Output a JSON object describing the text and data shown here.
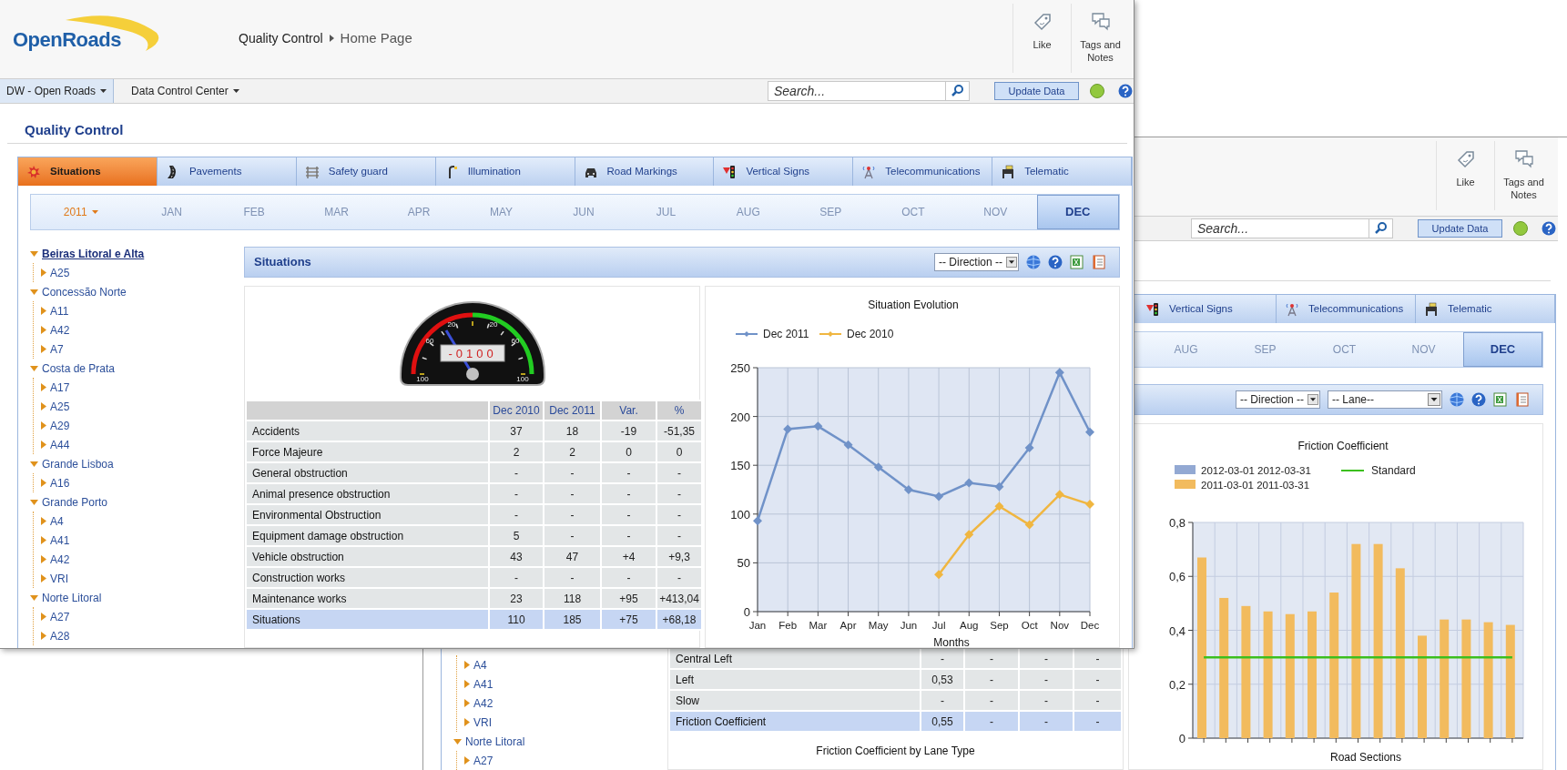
{
  "front_window": {
    "logo": "OpenRoads",
    "breadcrumb": [
      "Quality Control",
      "Home Page"
    ],
    "actions": [
      {
        "label": "Like"
      },
      {
        "label": "Tags and Notes"
      }
    ],
    "nav_menus": [
      {
        "label": "DW - Open Roads",
        "selected": true
      },
      {
        "label": "Data Control Center",
        "selected": false
      }
    ],
    "search": {
      "placeholder": "Search..."
    },
    "update_button": "Update Data",
    "page_heading": "Quality Control",
    "tabs": [
      {
        "label": "Situations",
        "selected": true
      },
      {
        "label": "Pavements",
        "selected": false
      },
      {
        "label": "Safety guard",
        "selected": false
      },
      {
        "label": "Illumination",
        "selected": false
      },
      {
        "label": "Road Markings",
        "selected": false
      },
      {
        "label": "Vertical Signs",
        "selected": false
      },
      {
        "label": "Telecommunications",
        "selected": false
      },
      {
        "label": "Telematic",
        "selected": false
      }
    ],
    "year": "2011",
    "months": [
      {
        "label": "JAN",
        "selected": false
      },
      {
        "label": "FEB",
        "selected": false
      },
      {
        "label": "MAR",
        "selected": false
      },
      {
        "label": "APR",
        "selected": false
      },
      {
        "label": "MAY",
        "selected": false
      },
      {
        "label": "JUN",
        "selected": false
      },
      {
        "label": "JUL",
        "selected": false
      },
      {
        "label": "AUG",
        "selected": false
      },
      {
        "label": "SEP",
        "selected": false
      },
      {
        "label": "OCT",
        "selected": false
      },
      {
        "label": "NOV",
        "selected": false
      },
      {
        "label": "DEC",
        "selected": true
      }
    ],
    "tree": [
      {
        "label": "Beiras Litoral e Alta",
        "expanded": true,
        "selected": true,
        "children": [
          {
            "label": "A25",
            "expanded": false,
            "selected": false
          }
        ]
      },
      {
        "label": "Concessão Norte",
        "expanded": true,
        "selected": false,
        "children": [
          {
            "label": "A11",
            "expanded": false,
            "selected": false
          },
          {
            "label": "A42",
            "expanded": false,
            "selected": false
          },
          {
            "label": "A7",
            "expanded": false,
            "selected": false
          }
        ]
      },
      {
        "label": "Costa de Prata",
        "expanded": true,
        "selected": false,
        "children": [
          {
            "label": "A17",
            "expanded": false,
            "selected": false
          },
          {
            "label": "A25",
            "expanded": false,
            "selected": false
          },
          {
            "label": "A29",
            "expanded": false,
            "selected": false
          },
          {
            "label": "A44",
            "expanded": false,
            "selected": false
          }
        ]
      },
      {
        "label": "Grande Lisboa",
        "expanded": true,
        "selected": false,
        "children": [
          {
            "label": "A16",
            "expanded": false,
            "selected": false
          }
        ]
      },
      {
        "label": "Grande Porto",
        "expanded": true,
        "selected": false,
        "children": [
          {
            "label": "A4",
            "expanded": false,
            "selected": false
          },
          {
            "label": "A41",
            "expanded": false,
            "selected": false
          },
          {
            "label": "A42",
            "expanded": false,
            "selected": false
          },
          {
            "label": "VRI",
            "expanded": false,
            "selected": false
          }
        ]
      },
      {
        "label": "Norte Litoral",
        "expanded": true,
        "selected": false,
        "children": [
          {
            "label": "A27",
            "expanded": false,
            "selected": false
          },
          {
            "label": "A28",
            "expanded": false,
            "selected": false
          }
        ]
      }
    ],
    "panel": {
      "title": "Situations",
      "filters": [
        "-- Direction --"
      ]
    },
    "gauge": {
      "scale_labels": [
        "100",
        "60",
        "20",
        "20",
        "60",
        "100"
      ],
      "readout": "-0100"
    },
    "table": {
      "columns": [
        "Dec 2010",
        "Dec 2011",
        "Var.",
        "%"
      ],
      "rows": [
        {
          "label": "Accidents",
          "values": [
            "37",
            "18",
            "-19",
            "-51,35"
          ],
          "kind": "data"
        },
        {
          "label": "Force Majeure",
          "values": [
            "2",
            "2",
            "0",
            "0"
          ],
          "kind": "data"
        },
        {
          "label": "General obstruction",
          "values": [
            "-",
            "-",
            "-",
            "-"
          ],
          "kind": "data"
        },
        {
          "label": "Animal presence obstruction",
          "values": [
            "-",
            "-",
            "-",
            "-"
          ],
          "kind": "data"
        },
        {
          "label": "Environmental Obstruction",
          "values": [
            "-",
            "-",
            "-",
            "-"
          ],
          "kind": "data"
        },
        {
          "label": "Equipment damage obstruction",
          "values": [
            "5",
            "-",
            "-",
            "-"
          ],
          "kind": "data"
        },
        {
          "label": "Vehicle obstruction",
          "values": [
            "43",
            "47",
            "+4",
            "+9,3"
          ],
          "kind": "data"
        },
        {
          "label": "Construction works",
          "values": [
            "-",
            "-",
            "-",
            "-"
          ],
          "kind": "data"
        },
        {
          "label": "Maintenance works",
          "values": [
            "23",
            "118",
            "+95",
            "+413,04"
          ],
          "kind": "data"
        },
        {
          "label": "Situations",
          "values": [
            "110",
            "185",
            "+75",
            "+68,18"
          ],
          "kind": "total"
        }
      ]
    },
    "chart": {
      "chart_data": {
        "type": "line",
        "title": "Situation Evolution",
        "xlabel": "Months",
        "categories": [
          "Jan",
          "Feb",
          "Mar",
          "Apr",
          "May",
          "Jun",
          "Jul",
          "Aug",
          "Sep",
          "Oct",
          "Nov",
          "Dec"
        ],
        "series": [
          {
            "name": "Dec 2011",
            "color": "#7092c8",
            "values": [
              93,
              187,
              190,
              171,
              148,
              125,
              118,
              132,
              128,
              168,
              245,
              184
            ],
            "marker": "diamond"
          },
          {
            "name": "Dec 2010",
            "color": "#f0b640",
            "values": [
              null,
              null,
              null,
              null,
              null,
              null,
              38,
              79,
              108,
              89,
              120,
              110
            ],
            "marker": "diamond"
          }
        ],
        "ylim": [
          0,
          250
        ],
        "yticks": [
          0,
          50,
          100,
          150,
          200,
          250
        ],
        "grid": true,
        "legend": true
      }
    }
  },
  "back_window": {
    "actions": [
      {
        "label": "Like"
      },
      {
        "label": "Tags and Notes"
      }
    ],
    "search": {
      "placeholder": "Search..."
    },
    "update_button": "Update Data",
    "tabs": [
      {
        "label": "Vertical Signs",
        "selected": false
      },
      {
        "label": "Telecommunications",
        "selected": false
      },
      {
        "label": "Telematic",
        "selected": false
      }
    ],
    "months": [
      {
        "label": "AUG",
        "selected": false
      },
      {
        "label": "SEP",
        "selected": false
      },
      {
        "label": "OCT",
        "selected": false
      },
      {
        "label": "NOV",
        "selected": false
      },
      {
        "label": "DEC",
        "selected": true
      }
    ],
    "tree": [
      {
        "children": [
          {
            "label": "A4",
            "expanded": false,
            "selected": false
          },
          {
            "label": "A41",
            "expanded": false,
            "selected": false
          },
          {
            "label": "A42",
            "expanded": false,
            "selected": false
          },
          {
            "label": "VRI",
            "expanded": false,
            "selected": false
          }
        ]
      },
      {
        "label": "Norte Litoral",
        "expanded": true,
        "selected": false,
        "children": [
          {
            "label": "A27",
            "expanded": false,
            "selected": false
          }
        ]
      }
    ],
    "panel": {
      "filters": [
        "-- Direction --",
        "-- Lane--"
      ]
    },
    "table": {
      "rows": [
        {
          "label": "Central Left",
          "values": [
            "-",
            "-",
            "-",
            "-"
          ],
          "kind": "data"
        },
        {
          "label": "Left",
          "values": [
            "0,53",
            "-",
            "-",
            "-"
          ],
          "kind": "data"
        },
        {
          "label": "Slow",
          "values": [
            "-",
            "-",
            "-",
            "-"
          ],
          "kind": "data"
        },
        {
          "label": "Friction Coefficient",
          "values": [
            "0,55",
            "-",
            "-",
            "-"
          ],
          "kind": "total"
        }
      ],
      "caption": "Friction Coefficient by Lane Type"
    },
    "chart": {
      "chart_data": {
        "type": "bar",
        "title": "Friction Coefficient",
        "xlabel": "Road Sections",
        "series": [
          {
            "name": "2012-03-01 2012-03-31",
            "color": "#93a9d3",
            "values": [
              null,
              null,
              null,
              null,
              null,
              null,
              null,
              null,
              null,
              null,
              null,
              null,
              null,
              null,
              null
            ]
          },
          {
            "name": "2011-03-01 2011-03-31",
            "color": "#f2bb5e",
            "values": [
              0.67,
              0.52,
              0.49,
              0.47,
              0.46,
              0.47,
              0.54,
              0.72,
              0.72,
              0.63,
              0.38,
              0.44,
              0.44,
              0.43,
              0.42
            ]
          },
          {
            "name": "Standard",
            "color": "#3cbf1e",
            "type": "line",
            "values": [
              0.3,
              0.3,
              0.3,
              0.3,
              0.3,
              0.3,
              0.3,
              0.3,
              0.3,
              0.3,
              0.3,
              0.3,
              0.3,
              0.3,
              0.3
            ]
          }
        ],
        "ylim": [
          0,
          0.8
        ],
        "yticks": [
          {
            "value": 0,
            "label": "0"
          },
          {
            "value": 0.2,
            "label": "0,2"
          },
          {
            "value": 0.4,
            "label": "0,4"
          },
          {
            "value": 0.6,
            "label": "0,6"
          },
          {
            "value": 0.8,
            "label": "0,8"
          }
        ],
        "grid": true,
        "legend": true
      }
    }
  }
}
